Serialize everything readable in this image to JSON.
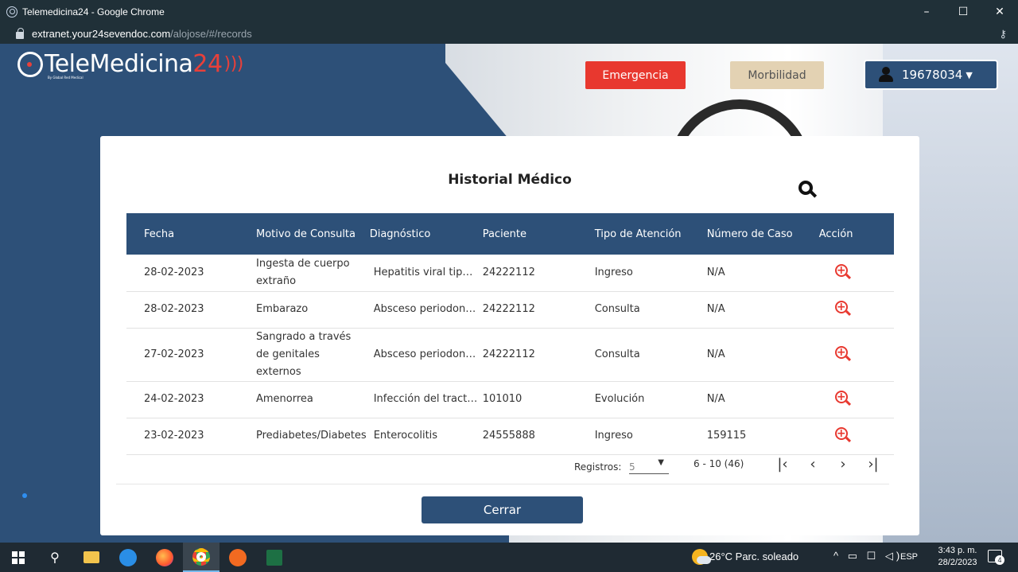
{
  "browser": {
    "window_title": "Telemedicina24 - Google Chrome",
    "url_host": "extranet.your24sevendoc.com",
    "url_path": "/alojose/#/records",
    "buttons": {
      "minimize": "–",
      "maximize": "☐",
      "close": "✕"
    },
    "key_icon": "key-icon"
  },
  "header": {
    "logo_text": "TeleMedicina",
    "logo_number": "24",
    "logo_sub": "By Global Red Medical",
    "emergency_label": "Emergencia",
    "morbidity_label": "Morbilidad",
    "user_id": "19678034",
    "user_caret": "▼"
  },
  "modal": {
    "title": "Historial Médico",
    "columns": [
      "Fecha",
      "Motivo de Consulta",
      "Diagnóstico",
      "Paciente",
      "Tipo de Atención",
      "Número de Caso",
      "Acción"
    ],
    "rows": [
      {
        "fecha": "28-02-2023",
        "motivo": "Ingesta de cuerpo extraño",
        "diagnostico": "Hepatitis viral tipo…",
        "paciente": "24222112",
        "tipo": "Ingreso",
        "caso": "N/A"
      },
      {
        "fecha": "28-02-2023",
        "motivo": "Embarazo",
        "diagnostico": "Absceso periodon…",
        "paciente": "24222112",
        "tipo": "Consulta",
        "caso": "N/A"
      },
      {
        "fecha": "27-02-2023",
        "motivo": "Sangrado a través de genitales externos",
        "diagnostico": "Absceso periodon…",
        "paciente": "24222112",
        "tipo": "Consulta",
        "caso": "N/A"
      },
      {
        "fecha": "24-02-2023",
        "motivo": "Amenorrea",
        "diagnostico": "Infección del tract…",
        "paciente": "101010",
        "tipo": "Evolución",
        "caso": "N/A"
      },
      {
        "fecha": "23-02-2023",
        "motivo": "Prediabetes/Diabetes",
        "diagnostico": "Enterocolitis",
        "paciente": "24555888",
        "tipo": "Ingreso",
        "caso": "159115"
      }
    ],
    "pagination": {
      "label": "Registros:",
      "page_size": "5",
      "range": "6 - 10 (46)",
      "first": "|‹",
      "prev": "‹",
      "next": "›",
      "last": "›|"
    },
    "close_label": "Cerrar"
  },
  "taskbar": {
    "weather": "26°C  Parc. soleado",
    "tray_icons": "^ ▭ ☐ ◁)",
    "lang": "ESP",
    "time": "3:43 p. m.",
    "date": "28/2/2023",
    "notif_count": "4"
  },
  "colors": {
    "brand_blue": "#2d5078",
    "emergency_red": "#e8382f",
    "morbidity_beige": "#e3d2b3"
  }
}
